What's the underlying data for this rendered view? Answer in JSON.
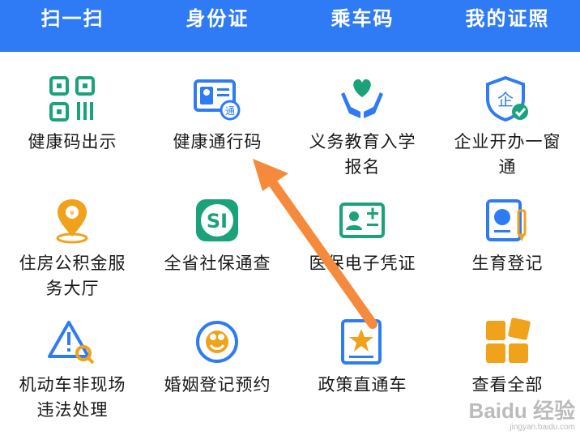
{
  "tabs": [
    "扫一扫",
    "身份证",
    "乘车码",
    "我的证照"
  ],
  "services": [
    {
      "label": "健康码出示",
      "icon": "qr-code-icon"
    },
    {
      "label": "健康通行码",
      "icon": "id-card-pass-icon"
    },
    {
      "label": "义务教育入学\n报名",
      "icon": "heart-hands-icon"
    },
    {
      "label": "企业开办一窗\n通",
      "icon": "enterprise-shield-icon"
    },
    {
      "label": "住房公积金服\n务大厅",
      "icon": "location-pin-icon"
    },
    {
      "label": "全省社保通查",
      "icon": "social-security-logo-icon"
    },
    {
      "label": "医保电子凭证",
      "icon": "medical-card-icon"
    },
    {
      "label": "生育登记",
      "icon": "baby-register-icon"
    },
    {
      "label": "机动车非现场\n违法处理",
      "icon": "warning-triangle-icon"
    },
    {
      "label": "婚姻登记预约",
      "icon": "marriage-icon"
    },
    {
      "label": "政策直通车",
      "icon": "policy-star-icon"
    },
    {
      "label": "查看全部",
      "icon": "all-apps-grid-icon"
    }
  ],
  "colors": {
    "header": "#2f7bf5",
    "icon_blue": "#2f7bf5",
    "icon_teal": "#1aa37a",
    "icon_gold": "#f0a21b",
    "arrow": "#f58a3c"
  },
  "watermark": {
    "main": "Baidu 经验",
    "sub": "jingyan.baidu.com"
  }
}
